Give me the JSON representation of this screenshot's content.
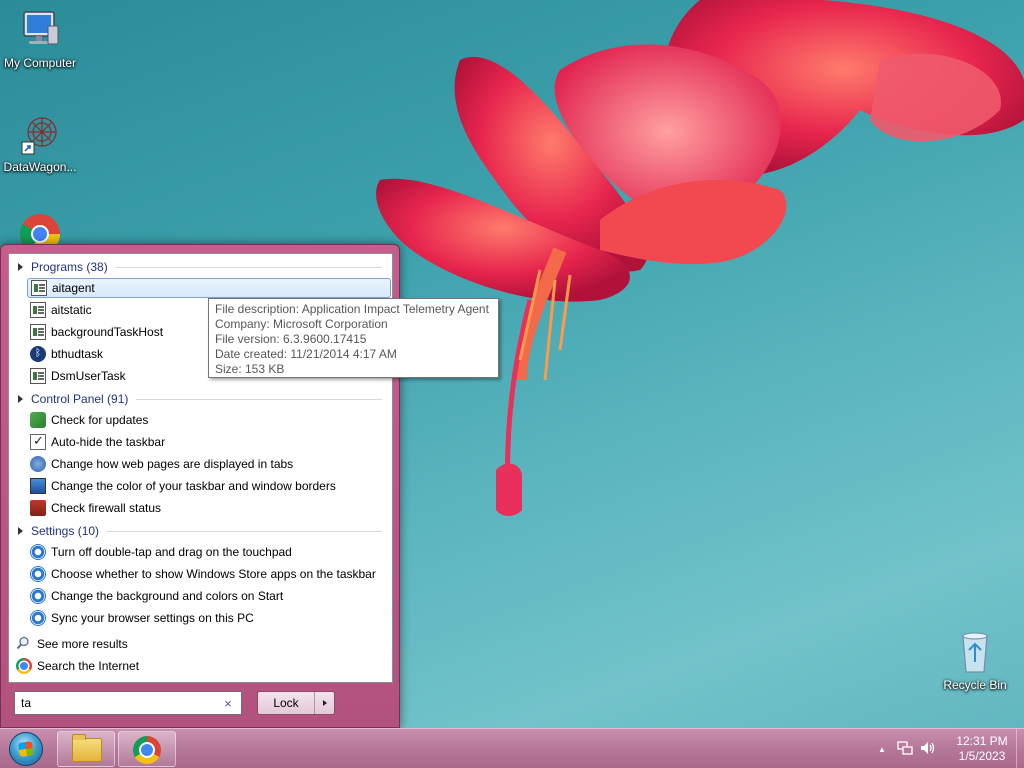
{
  "desktop": {
    "icons": [
      {
        "label": "My Computer",
        "icon": "monitor-icon"
      },
      {
        "label": "DataWagon...",
        "icon": "datawagon-icon"
      },
      {
        "label": "",
        "icon": "chrome-icon"
      },
      {
        "label": "Recycle Bin",
        "icon": "recycle-bin-icon"
      }
    ]
  },
  "start_menu": {
    "groups": [
      {
        "header": "Programs (38)",
        "items": [
          {
            "label": "aitagent",
            "icon": "app-icon",
            "selected": true
          },
          {
            "label": "aitstatic",
            "icon": "app-icon"
          },
          {
            "label": "backgroundTaskHost",
            "icon": "app-icon"
          },
          {
            "label": "bthudtask",
            "icon": "bluetooth-icon"
          },
          {
            "label": "DsmUserTask",
            "icon": "app-icon"
          }
        ]
      },
      {
        "header": "Control Panel (91)",
        "items": [
          {
            "label": "Check for updates",
            "icon": "windows-update-icon"
          },
          {
            "label": "Auto-hide the taskbar",
            "icon": "taskbar-icon"
          },
          {
            "label": "Change how web pages are displayed in tabs",
            "icon": "internet-options-icon"
          },
          {
            "label": "Change the color of your taskbar and window borders",
            "icon": "personalization-icon"
          },
          {
            "label": "Check firewall status",
            "icon": "firewall-icon"
          }
        ]
      },
      {
        "header": "Settings (10)",
        "items": [
          {
            "label": "Turn off double-tap and drag on the touchpad",
            "icon": "gear-icon"
          },
          {
            "label": "Choose whether to show Windows Store apps on the taskbar",
            "icon": "gear-icon"
          },
          {
            "label": "Change the background and colors on Start",
            "icon": "gear-icon"
          },
          {
            "label": "Sync your browser settings on this PC",
            "icon": "gear-icon"
          }
        ]
      }
    ],
    "see_more": "See more results",
    "search_internet": "Search the Internet",
    "search_value": "ta",
    "search_clear": "×",
    "lock_label": "Lock"
  },
  "tooltip": {
    "lines": [
      "File description: Application Impact Telemetry Agent",
      "Company: Microsoft Corporation",
      "File version: 6.3.9600.17415",
      "Date created: 11/21/2014 4:17 AM",
      "Size: 153 KB"
    ]
  },
  "taskbar": {
    "pinned": [
      {
        "name": "file-explorer-icon"
      },
      {
        "name": "chrome-icon"
      }
    ],
    "tray": {
      "show_hidden": "▲",
      "network_icon": "network-icon",
      "volume_icon": "volume-icon"
    },
    "clock": {
      "time": "12:31 PM",
      "date": "1/5/2023"
    }
  },
  "colors": {
    "accent_header": "#1e3287",
    "menu_frame": "#b2527e",
    "taskbar": "#b67899"
  }
}
